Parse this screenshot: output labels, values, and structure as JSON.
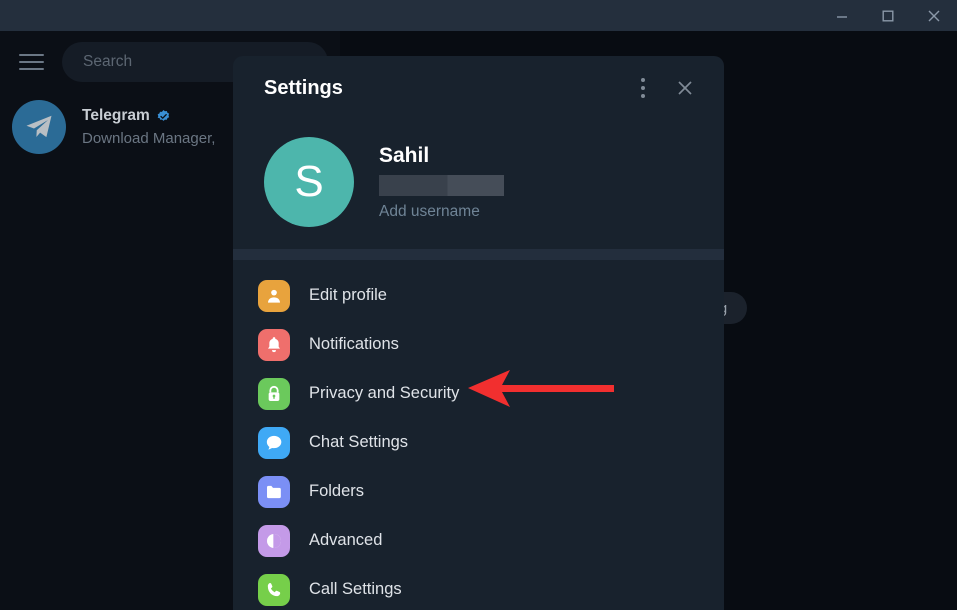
{
  "window": {
    "minimize_label": "Minimize",
    "maximize_label": "Maximize",
    "close_label": "Close"
  },
  "sidebar": {
    "menu_icon": "hamburger-menu-icon",
    "search": {
      "placeholder": "Search",
      "value": "Search"
    },
    "chats": [
      {
        "name": "Telegram",
        "verified": true,
        "preview": "Download Manager,",
        "avatar_icon": "telegram-paper-plane-icon",
        "avatar_color": "#2b6b96"
      }
    ]
  },
  "main": {
    "pill_label": "saging"
  },
  "dialog": {
    "title": "Settings",
    "kebab_icon": "more-vertical-icon",
    "close_icon": "close-icon",
    "profile": {
      "avatar_initial": "S",
      "avatar_color": "#4db6ac",
      "name": "Sahil",
      "phone_redacted": true,
      "username_label": "Add username"
    },
    "menu_items": [
      {
        "label": "Edit profile",
        "icon": "person-icon",
        "color": "#e8a33d"
      },
      {
        "label": "Notifications",
        "icon": "bell-icon",
        "color": "#ef6f6c"
      },
      {
        "label": "Privacy and Security",
        "icon": "lock-icon",
        "color": "#6bc95c"
      },
      {
        "label": "Chat Settings",
        "icon": "chat-bubble-icon",
        "color": "#3fa9f5"
      },
      {
        "label": "Folders",
        "icon": "folder-icon",
        "color": "#7b8ff5"
      },
      {
        "label": "Advanced",
        "icon": "contrast-icon",
        "color": "#c49ae8"
      },
      {
        "label": "Call Settings",
        "icon": "phone-icon",
        "color": "#76cf4a"
      }
    ]
  },
  "annotation": {
    "arrow_color": "#f22f2f",
    "points_to": "Privacy and Security"
  }
}
